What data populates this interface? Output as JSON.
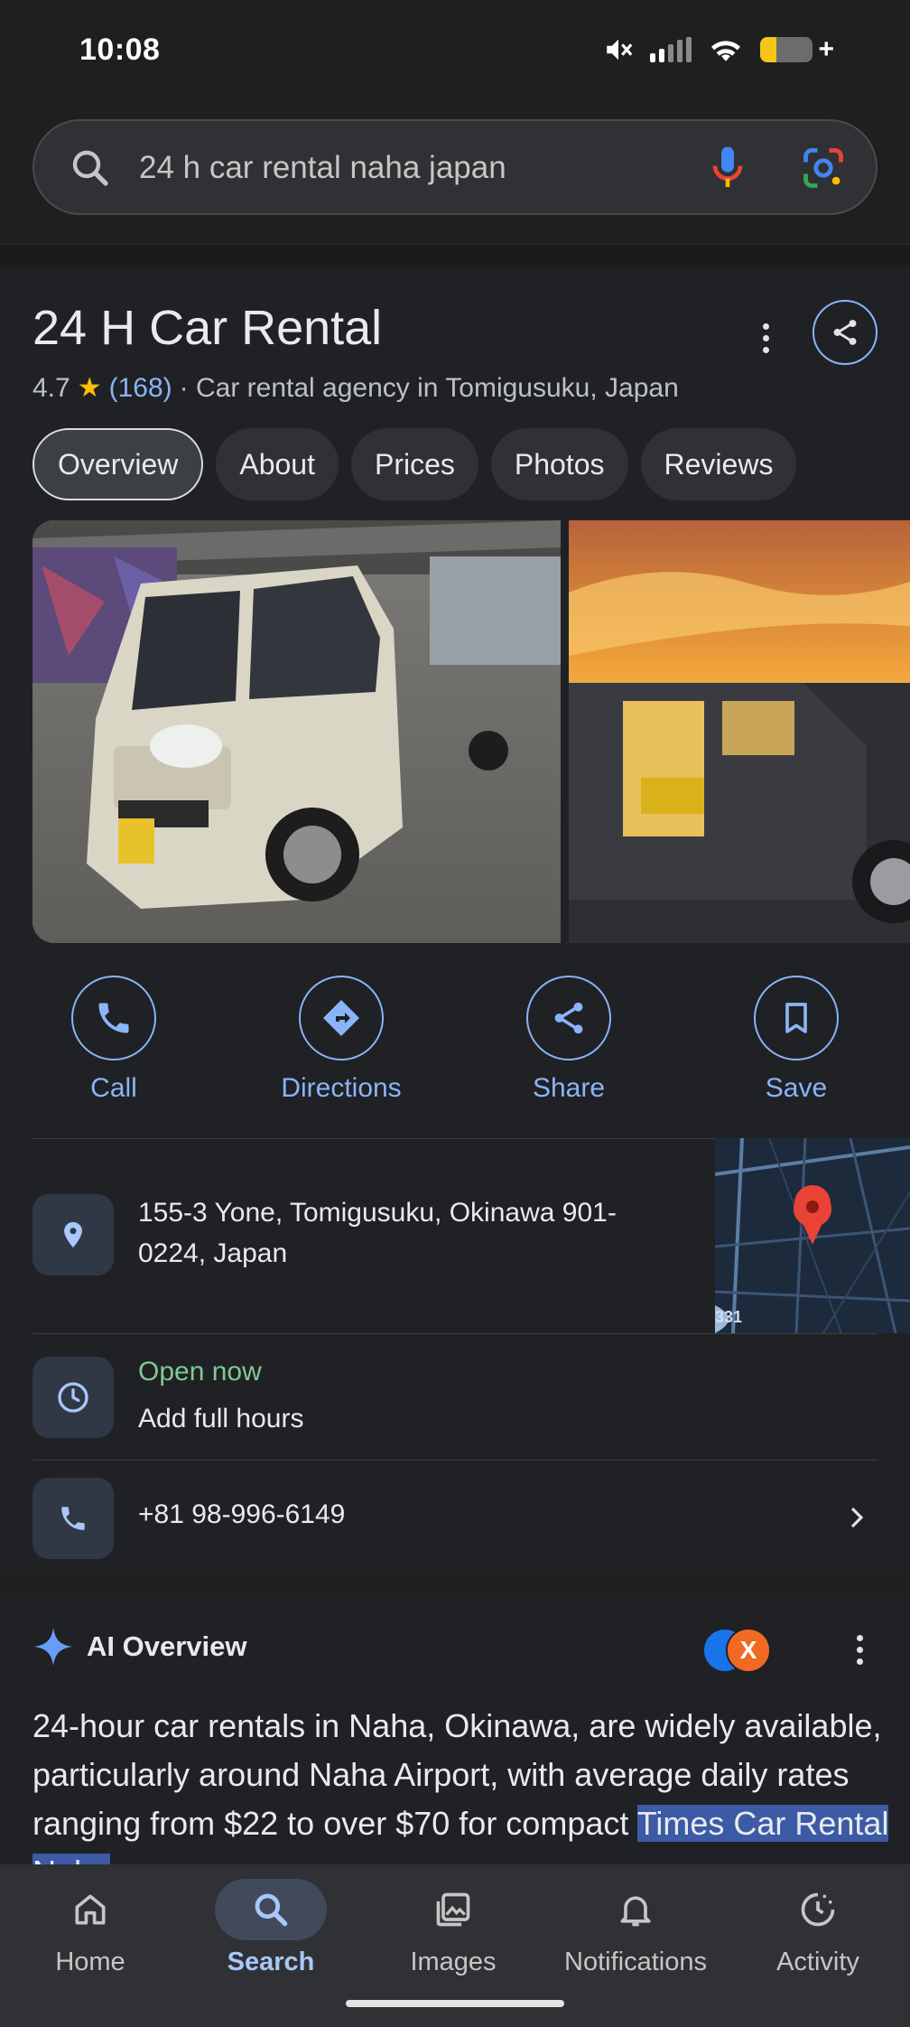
{
  "status_bar": {
    "time": "10:08",
    "battery_percent": 30
  },
  "search": {
    "query": "24 h car rental naha japan"
  },
  "business": {
    "name": "24 H Car Rental",
    "rating": "4.7",
    "review_count": "(168)",
    "category": "· Car rental agency in Tomigusuku, Japan",
    "tabs": [
      "Overview",
      "About",
      "Prices",
      "Photos",
      "Reviews"
    ],
    "active_tab": "Overview",
    "actions": {
      "call": "Call",
      "directions": "Directions",
      "share": "Share",
      "save": "Save"
    },
    "address": "155-3 Yone, Tomigusuku, Okinawa 901-0224, Japan",
    "map_route_label": "331",
    "open_status": "Open now",
    "hours_link": "Add full hours",
    "phone": "+81 98-996-6149"
  },
  "ai_overview": {
    "title": "AI Overview",
    "source_badge": "X",
    "body": "24-hour car rentals in Naha, Okinawa, are widely available, particularly around Naha Airport, with average daily rates ranging from $22 to over $70 for compact",
    "highlight": "Times Car Rental Naha"
  },
  "bottom_nav": {
    "home": "Home",
    "search": "Search",
    "images": "Images",
    "notifications": "Notifications",
    "activity": "Activity"
  },
  "colors": {
    "accent": "#8ab4f8",
    "open": "#81c995",
    "star": "#fbbc04"
  }
}
